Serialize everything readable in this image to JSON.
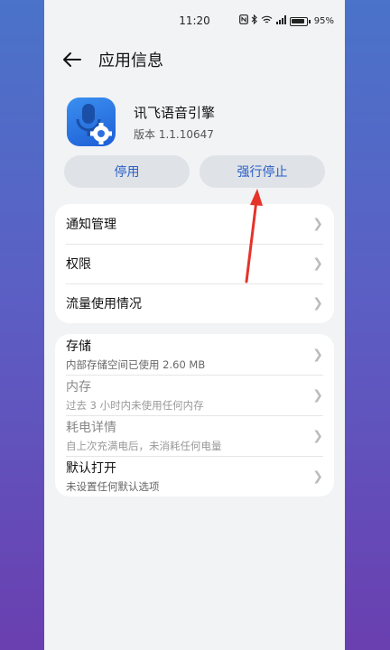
{
  "status_bar": {
    "time": "11:20",
    "battery_percent": "95%"
  },
  "header": {
    "title": "应用信息"
  },
  "app": {
    "name": "讯飞语音引擎",
    "version": "版本 1.1.10647"
  },
  "buttons": {
    "disable": "停用",
    "force_stop": "强行停止"
  },
  "section1": [
    {
      "label": "通知管理"
    },
    {
      "label": "权限"
    },
    {
      "label": "流量使用情况"
    }
  ],
  "section2": [
    {
      "label": "存储",
      "sub": "内部存储空间已使用 2.60 MB"
    },
    {
      "label": "内存",
      "sub": "过去 3 小时内未使用任何内存"
    },
    {
      "label": "耗电详情",
      "sub": "自上次充满电后，未消耗任何电量"
    },
    {
      "label": "默认打开",
      "sub": "未设置任何默认选项"
    }
  ],
  "colors": {
    "accent": "#2a5fc8",
    "annotation_arrow": "#e5332a"
  },
  "icons": [
    "nfc-icon",
    "bluetooth-icon",
    "wifi-icon",
    "signal-icon",
    "battery-icon",
    "back-arrow-icon",
    "microphone-gear-app-icon",
    "chevron-right-icon"
  ]
}
